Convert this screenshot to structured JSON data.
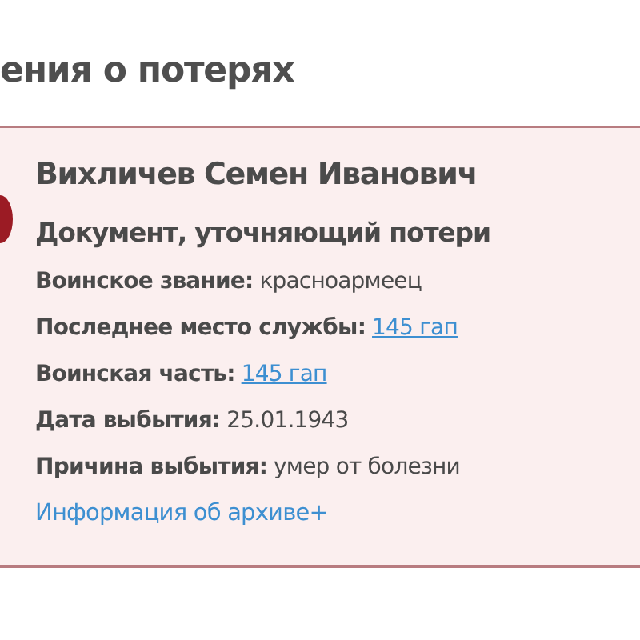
{
  "heading": "ения о потерях",
  "card": {
    "name": "Вихличев Семен Иванович",
    "document": "Документ, уточняющий потери",
    "fields": [
      {
        "label": "Воинское звание:",
        "value": "красноармеец",
        "kind": "text"
      },
      {
        "label": "Последнее место службы:",
        "value": "145 гап",
        "kind": "link"
      },
      {
        "label": "Воинская часть:",
        "value": "145 гап",
        "kind": "link"
      },
      {
        "label": "Дата выбытия:",
        "value": "25.01.1943",
        "kind": "text"
      },
      {
        "label": "Причина выбытия:",
        "value": "умер от болезни",
        "kind": "text"
      }
    ],
    "archive_link": "Информация об архиве+"
  }
}
